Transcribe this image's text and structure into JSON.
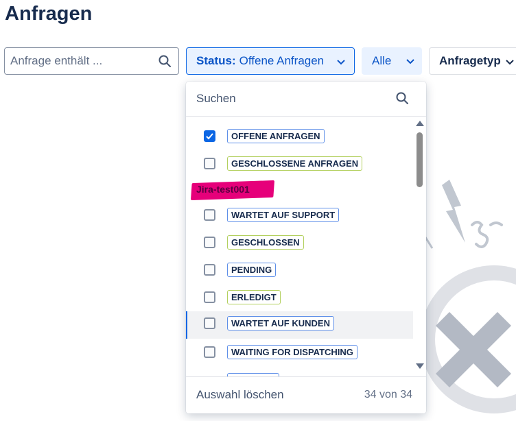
{
  "page": {
    "title": "Anfragen"
  },
  "search": {
    "placeholder": "Anfrage enthält ..."
  },
  "filters": {
    "status": {
      "label": "Status:",
      "value": "Offene Anfragen"
    },
    "scope": {
      "label": "Alle"
    },
    "type": {
      "label": "Anfragetyp"
    }
  },
  "dropdown": {
    "search_placeholder": "Suchen",
    "options_top": [
      {
        "label": "Offene Anfragen",
        "checked": true,
        "style": "blue"
      },
      {
        "label": "Geschlossene Anfragen",
        "checked": false,
        "style": "green"
      }
    ],
    "group_label": "Jira-test001",
    "options_group": [
      {
        "label": "Wartet auf Support",
        "checked": false,
        "style": "blue"
      },
      {
        "label": "Geschlossen",
        "checked": false,
        "style": "green"
      },
      {
        "label": "Pending",
        "checked": false,
        "style": "blue"
      },
      {
        "label": "Erledigt",
        "checked": false,
        "style": "green"
      },
      {
        "label": "Wartet auf Kunden",
        "checked": false,
        "style": "blue",
        "highlighted": true
      },
      {
        "label": "Waiting for dispatching",
        "checked": false,
        "style": "blue"
      }
    ],
    "footer": {
      "clear_label": "Auswahl löschen",
      "count": "34 von 34"
    }
  },
  "colors": {
    "accent": "#0c66e4",
    "lozenge_blue_border": "#5e8fe8",
    "lozenge_green_border": "#b3d05e",
    "annotation_highlight": "#e6007a"
  }
}
